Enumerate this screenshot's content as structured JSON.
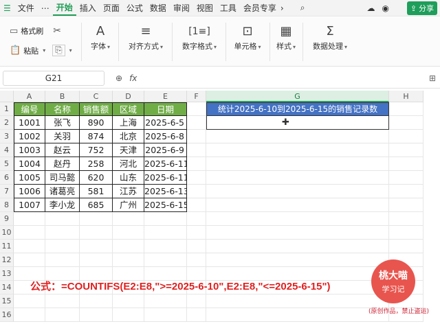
{
  "menu": {
    "file": "文件",
    "more": "⋯",
    "tabs": [
      "开始",
      "插入",
      "页面",
      "公式",
      "数据",
      "审阅",
      "视图",
      "工具",
      "会员专享"
    ],
    "active_tab": "开始",
    "share": "分享"
  },
  "ribbon": {
    "format_painter": "格式刷",
    "paste": "粘贴",
    "font": "字体",
    "align": "对齐方式",
    "number_format": "数字格式",
    "cell": "单元格",
    "style": "样式",
    "data_process": "数据处理"
  },
  "formula_bar": {
    "name_box": "G21",
    "fx": "fx",
    "value": ""
  },
  "columns": [
    "A",
    "B",
    "C",
    "D",
    "E",
    "F",
    "G",
    "H"
  ],
  "rows": [
    "1",
    "2",
    "3",
    "4",
    "5",
    "6",
    "7",
    "8",
    "9",
    "10",
    "11",
    "12",
    "13",
    "14",
    "15",
    "16"
  ],
  "table": {
    "headers": [
      "编号",
      "名称",
      "销售额",
      "区域",
      "日期"
    ],
    "rows": [
      [
        "1001",
        "张飞",
        "890",
        "上海",
        "2025-6-5"
      ],
      [
        "1002",
        "关羽",
        "874",
        "北京",
        "2025-6-8"
      ],
      [
        "1003",
        "赵云",
        "752",
        "天津",
        "2025-6-9"
      ],
      [
        "1004",
        "赵丹",
        "258",
        "河北",
        "2025-6-11"
      ],
      [
        "1005",
        "司马懿",
        "620",
        "山东",
        "2025-6-11"
      ],
      [
        "1006",
        "诸葛亮",
        "581",
        "江苏",
        "2025-6-13"
      ],
      [
        "1007",
        "李小龙",
        "685",
        "广州",
        "2025-6-15"
      ]
    ]
  },
  "g_header": "统计2025-6-10到2025-6-15的销售记录数",
  "g_value": "",
  "formula_text": "公式：=COUNTIFS(E2:E8,\">=2025-6-10\",E2:E8,\"<=2025-6-15\")",
  "stamp": {
    "name": "桃大喵",
    "sub": "学习记",
    "note": "(原创作品，禁止盗运)"
  },
  "colors": {
    "accent": "#1e9e5a",
    "table_header": "#70ad47",
    "g_header": "#4472c4",
    "formula_text": "#e02020"
  }
}
